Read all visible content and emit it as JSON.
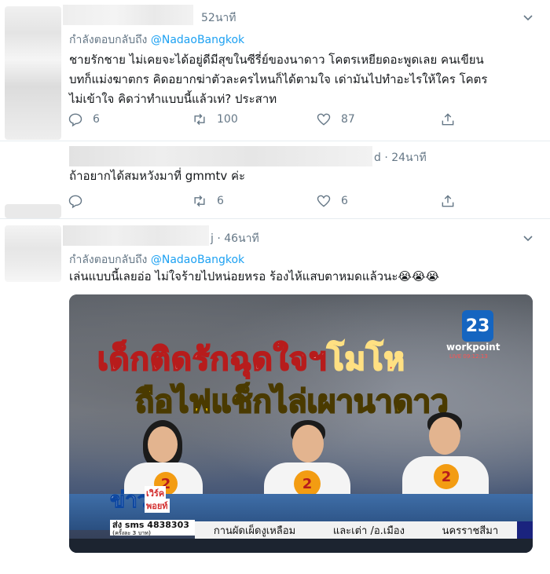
{
  "tweets": [
    {
      "time": "52นาที",
      "replying_prefix": "กำลังตอบกลับถึง",
      "replying_handle": "@NadaoBangkok",
      "text_lines": [
        "ชายรักชาย ไม่เคยจะได้อยู่ดีมีสุขในซีรี่ย์ของนาดาว โคตรเหยียดอะพูดเลย คนเขียน",
        "บทก็แม่งฆาตกร คิดอยากฆ่าตัวละครไหนก็ได้ตามใจ เด่ามันไปทำอะไรให้ใคร โคตร",
        "ไม่เข้าใจ คิดว่าทำแบบนี้แล้วเท่? ประสาท"
      ],
      "replies": "6",
      "retweets": "100",
      "likes": "87"
    },
    {
      "time": "d · 24นาที",
      "text_lines": [
        "ถ้าอยากได้สมหวังมาที่ gmmtv ค่ะ"
      ],
      "replies": "",
      "retweets": "6",
      "likes": "6"
    },
    {
      "time": "j · 46นาที",
      "replying_prefix": "กำลังตอบกลับถึง",
      "replying_handle": "@NadaoBangkok",
      "text_lines": [
        "เล่นแบบนี้เลยอ่อ ไม่ใจร้ายไปหน่อยหรอ ร้องไห้แสบตาหมดแล้วนะ😭😭😭"
      ]
    }
  ],
  "media": {
    "headline_line1_white": "เด็กติดรักฉุดใจฯ",
    "headline_line1_red": "โมโห",
    "headline_line2": "ถือไฟแช็กไล่เผานาดาว",
    "channel_number": "23",
    "channel_name": "workpoint",
    "channel_live": "LIVE 09:12:13",
    "show_logo_big": "ข่าว",
    "show_logo_small1": "เวิร์ค",
    "show_logo_small2": "พอยท์",
    "sms_text": "ส่ง sms 4838303",
    "sms_small": "(ครั้งละ 3 บาท)",
    "ticker_items": [
      "กานผัดเผ็ดงูเหลือม",
      "และเต่า /อ.เมือง",
      "นครราชสีมา"
    ]
  },
  "icons": {
    "reply": "reply-icon",
    "retweet": "retweet-icon",
    "like": "heart-icon",
    "share": "share-icon",
    "menu": "chevron-down-icon"
  },
  "colors": {
    "link": "#1da1f2",
    "muted": "#657786",
    "text": "#14171a"
  }
}
